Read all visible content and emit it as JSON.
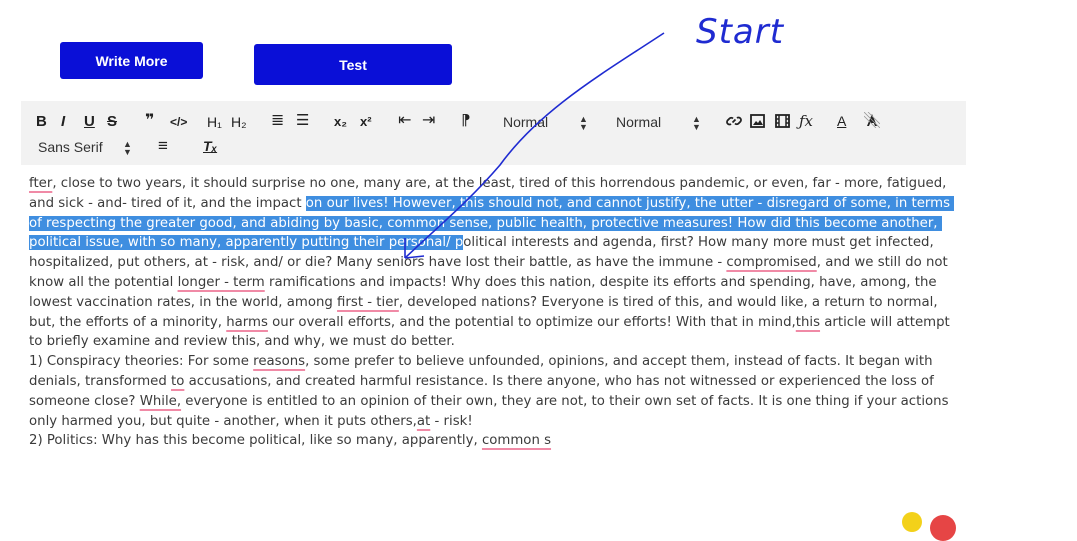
{
  "buttons": {
    "write_more": "Write More",
    "test": "Test"
  },
  "toolbar": {
    "bold": "B",
    "italic": "I",
    "underline": "U",
    "strike": "S",
    "quote": "❞",
    "code": "</>",
    "h1": "H₁",
    "h2": "H₂",
    "ordered_list": "≣",
    "bullet_list": "☰",
    "subscript": "x₂",
    "superscript": "x²",
    "outdent": "⇤",
    "indent": "⇥",
    "direction": "⁋",
    "size_select": "Normal",
    "header_select": "Normal",
    "font_select": "Sans Serif",
    "align": "≡",
    "clear_format": "Tₓ",
    "colors": {
      "accent_button": "#0a0fd7",
      "selection": "#3f8ee0",
      "spell": "#f08aa6",
      "annotation": "#1f2bd1"
    }
  },
  "editor": {
    "seg1": "fter",
    "seg2": ", close to two years, it should surprise no one, many are, at the least, tired of this horrendous pandemic, or even, far - more, fatigued, and sick - and- tired of it, and the impact ",
    "selected": "on our lives! However, this should not, and cannot justify, the utter - disregard of some, in terms of respecting the greater good, and abiding by basic, common sense, public health, protective measures! How did this become another, political issue, with so many, apparently putting their personal/ p",
    "seg3": "olitical interests and agenda, first? How many more must get infected, hospitalized, put others, at - risk, and/ or die? Many seniors have lost their battle, as have the immune - ",
    "sp_compromised": "compromised",
    "seg4": ", and we still do not know all the potential ",
    "sp_longterm": "longer - term",
    "seg5": " ramifications and impacts! Why does this nation, despite its efforts and spending, have, among, the lowest vaccination rates, in the world, among ",
    "sp_firsttier": "first - tier",
    "seg6": ", developed nations? Everyone is tired of this, and would like, a return to normal, but, the efforts of a minority, ",
    "sp_harms": "harms",
    "seg7": " our overall efforts, and the potential to optimize our efforts! With that in mind,",
    "sp_this": "this",
    "seg8": " article will attempt to briefly examine and review this, and why, we must do better.\n1) Conspiracy theories: For some ",
    "sp_reasons": "reasons",
    "seg9": ", some prefer to believe unfounded, opinions, and accept them, instead of facts. It began with denials, transformed ",
    "sp_to": "to",
    "seg10": " accusations, and created harmful resistance. Is there anyone, who has not witnessed or experienced the loss of someone close? ",
    "sp_while": "While,",
    "seg11": " everyone is entitled to an opinion of their own, they are not, to their own set of facts. It is one thing if your actions only harmed you, but quite - another, when it puts others,",
    "sp_at": "at",
    "seg12": " - risk!\n2) Politics: Why has this become political, like so many, apparently, ",
    "sp_common": "common s"
  },
  "annotation": {
    "label": "Start"
  }
}
